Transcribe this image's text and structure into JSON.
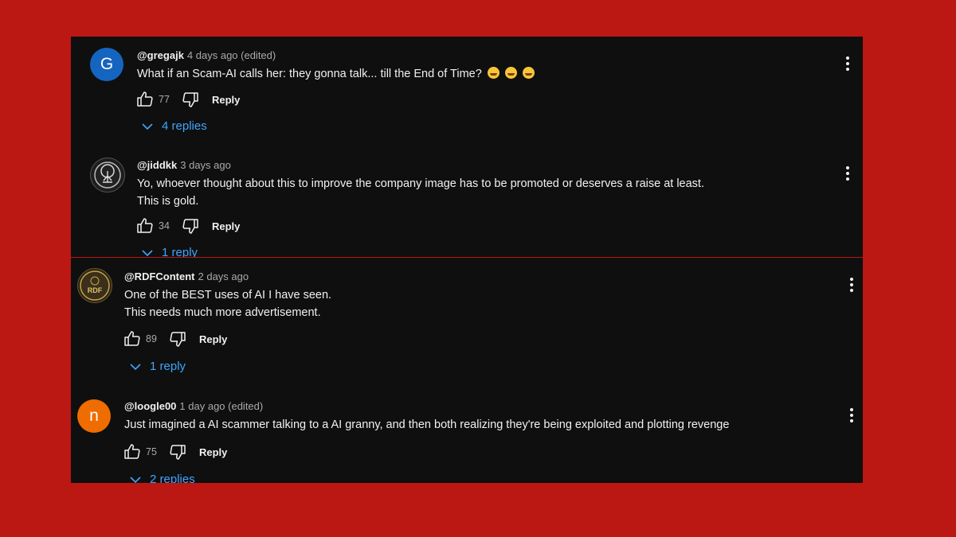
{
  "colors": {
    "background": "#bb1713",
    "panel": "#0f0f0f",
    "link": "#3ea6ff"
  },
  "reply_label": "Reply",
  "comments": [
    {
      "avatar_letter": "G",
      "avatar_color": "#1565c0",
      "handle": "@gregajk",
      "time": "4 days ago (edited)",
      "lines": [
        "What if an Scam-AI calls her: they gonna talk... till the End of Time?"
      ],
      "emojis": [
        "grinning-squinting-face",
        "grinning-squinting-face",
        "grinning-sweat-face"
      ],
      "likes": "77",
      "replies": "4 replies"
    },
    {
      "avatar_icon": "tree-of-life-icon",
      "handle": "@jiddkk",
      "time": "3 days ago",
      "lines": [
        "Yo, whoever thought about this to improve the company image has to be promoted or deserves a raise at least.",
        "This is gold."
      ],
      "likes": "34",
      "replies": "1 reply"
    },
    {
      "avatar_text": "RDF",
      "handle": "@RDFContent",
      "time": "2 days ago",
      "lines": [
        "One of the BEST uses of AI I have seen.",
        "This needs much more advertisement."
      ],
      "likes": "89",
      "replies": "1 reply"
    },
    {
      "avatar_letter": "n",
      "avatar_color": "#ef6c00",
      "handle": "@loogle00",
      "time": "1 day ago (edited)",
      "lines": [
        "Just imagined a AI scammer talking to a AI granny, and then both realizing they're being exploited and plotting revenge"
      ],
      "likes": "75",
      "replies": "2 replies"
    }
  ]
}
